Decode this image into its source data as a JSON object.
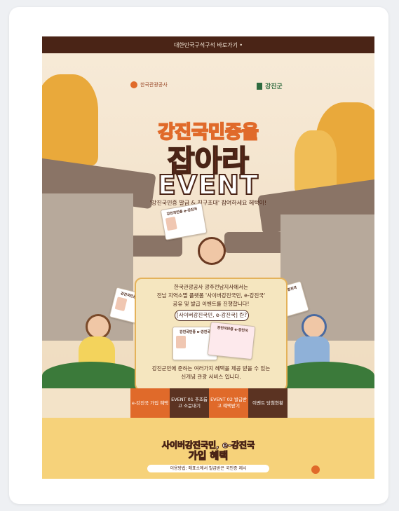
{
  "topbar": {
    "text": "대한민국구석구석 바로가기 •"
  },
  "logos": {
    "left": "한국관광공사",
    "right": "강진군"
  },
  "hero": {
    "line1": "강진국민증을",
    "line2": "잡아라",
    "line3": "EVENT",
    "subtitle": "'강진국민증 발급 & 친구초대' 참여하세요 혜택이!"
  },
  "info": {
    "line1": "한국관광공사 광주전남지사에서는",
    "line2": "전남 지역소멸 플랫폼 '사이버강진국민, e-강진국'",
    "line3": "공유 및 발급 이벤트를 진행합니다!",
    "pill": "[사이버강진국민, e-강진국] 란?",
    "desc1": "강진군민에 준하는 여러가지 혜택을 제공 받을 수 있는",
    "desc2": "신개념 관광 서비스 입니다."
  },
  "idcard": {
    "title": "강진국민증 e-강진국"
  },
  "menu": [
    {
      "label": "e-강진국 가입 혜택",
      "color": "#e06a2a"
    },
    {
      "label": "EVENT 01 추조롭고 소문내기",
      "color": "#5b3322"
    },
    {
      "label": "EVENT 02 발급받고 혜택받기",
      "color": "#e06a2a"
    },
    {
      "label": "이벤트 당첨현황",
      "color": "#5b3322"
    }
  ],
  "bottom": {
    "line1": "사이버강진국민, e-강진국",
    "line2": "가입 혜택",
    "note": "이용방법: 매표소에서 발급받은 국민증 제시"
  }
}
